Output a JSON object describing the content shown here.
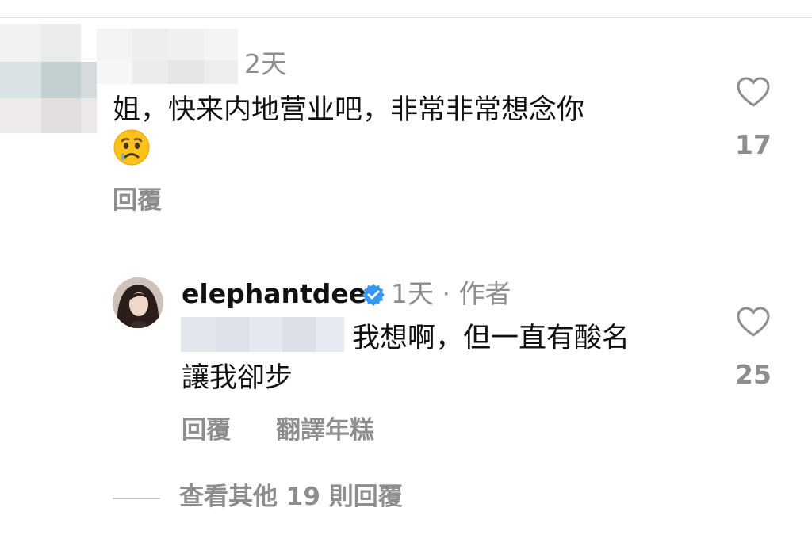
{
  "comment1": {
    "time": "2天",
    "text_line1": "姐，快来内地营业吧，非常非常想念你",
    "emoji": "crying-face",
    "reply_label": "回覆",
    "like_count": "17"
  },
  "comment2": {
    "username": "elephantdee",
    "time_author": "1天 · 作者",
    "text_line1": "我想啊，但一直有酸名",
    "text_line2": "讓我卻步",
    "reply_label": "回覆",
    "translate_label": "翻譯年糕",
    "like_count": "25"
  },
  "view_more": "查看其他 19 則回覆",
  "colors": {
    "secondary_text": "#8e8e8e",
    "verified_blue": "#3897f0"
  }
}
